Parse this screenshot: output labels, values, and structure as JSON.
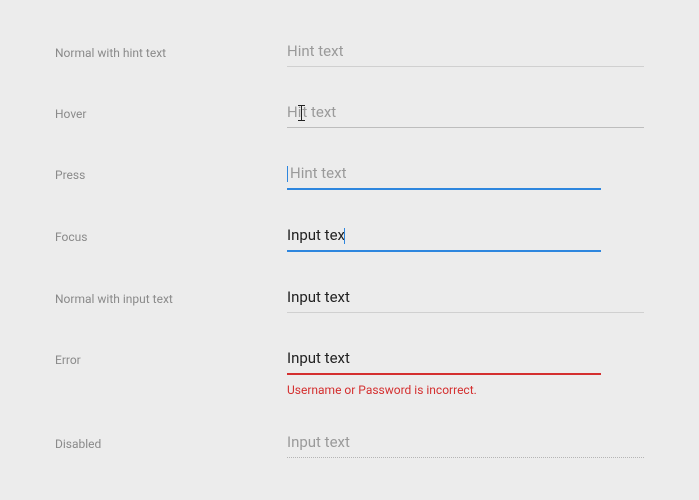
{
  "rows": {
    "normal_hint": {
      "label": "Normal with hint text",
      "placeholder": "Hint text"
    },
    "hover": {
      "label": "Hover",
      "placeholder_part1": "Hi",
      "placeholder_part2": "t text"
    },
    "press": {
      "label": "Press",
      "placeholder": "Hint text"
    },
    "focus": {
      "label": "Focus",
      "value": "Input tex"
    },
    "normal_input": {
      "label": "Normal with input text",
      "value": "Input text"
    },
    "error": {
      "label": "Error",
      "value": "Input text",
      "error_message": "Username or Password is incorrect."
    },
    "disabled": {
      "label": "Disabled",
      "value": "Input text"
    }
  },
  "colors": {
    "accent": "#2e86de",
    "error": "#d42f2f",
    "hint": "#9a9a9a",
    "text": "#222222"
  }
}
